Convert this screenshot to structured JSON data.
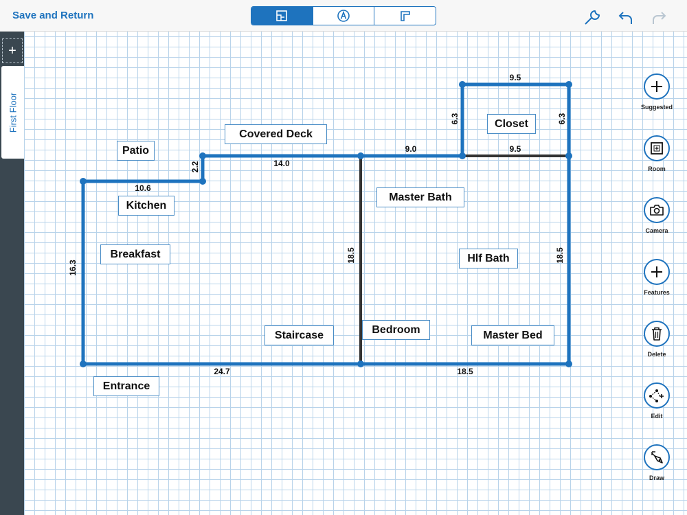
{
  "header": {
    "back_label": "Save and Return",
    "segments": [
      {
        "icon": "floorplan-icon",
        "active": true
      },
      {
        "icon": "annotate-icon",
        "active": false
      },
      {
        "icon": "wall-icon",
        "active": false
      }
    ],
    "right_icons": [
      "wrench-icon",
      "undo-icon",
      "redo-icon"
    ]
  },
  "sidebar": {
    "add_label": "+",
    "floor_tab": "First Floor"
  },
  "rooms": [
    {
      "label": "Patio"
    },
    {
      "label": "Covered Deck"
    },
    {
      "label": "Closet"
    },
    {
      "label": "Kitchen"
    },
    {
      "label": "Master Bath"
    },
    {
      "label": "Breakfast"
    },
    {
      "label": "Hlf Bath"
    },
    {
      "label": "Staircase"
    },
    {
      "label": "Bedroom"
    },
    {
      "label": "Master Bed"
    },
    {
      "label": "Entrance"
    }
  ],
  "dimensions": [
    {
      "value": "9.5"
    },
    {
      "value": "6.3"
    },
    {
      "value": "6.3"
    },
    {
      "value": "9.0"
    },
    {
      "value": "9.5"
    },
    {
      "value": "2.2"
    },
    {
      "value": "14.0"
    },
    {
      "value": "10.6"
    },
    {
      "value": "16.3"
    },
    {
      "value": "18.5"
    },
    {
      "value": "18.5"
    },
    {
      "value": "24.7"
    },
    {
      "value": "18.5"
    }
  ],
  "tools": [
    {
      "label": "Suggested",
      "icon": "plus-icon"
    },
    {
      "label": "Room",
      "icon": "room-icon"
    },
    {
      "label": "Camera",
      "icon": "camera-icon"
    },
    {
      "label": "Features",
      "icon": "plus-icon"
    },
    {
      "label": "Delete",
      "icon": "trash-icon"
    },
    {
      "label": "Edit",
      "icon": "edit-nodes-icon"
    },
    {
      "label": "Draw",
      "icon": "pen-icon"
    }
  ],
  "colors": {
    "accent": "#1e73be",
    "wall": "#1e73be",
    "interior_wall": "#333333",
    "sidebar": "#3a4750",
    "grid": "#b8d3ea"
  }
}
